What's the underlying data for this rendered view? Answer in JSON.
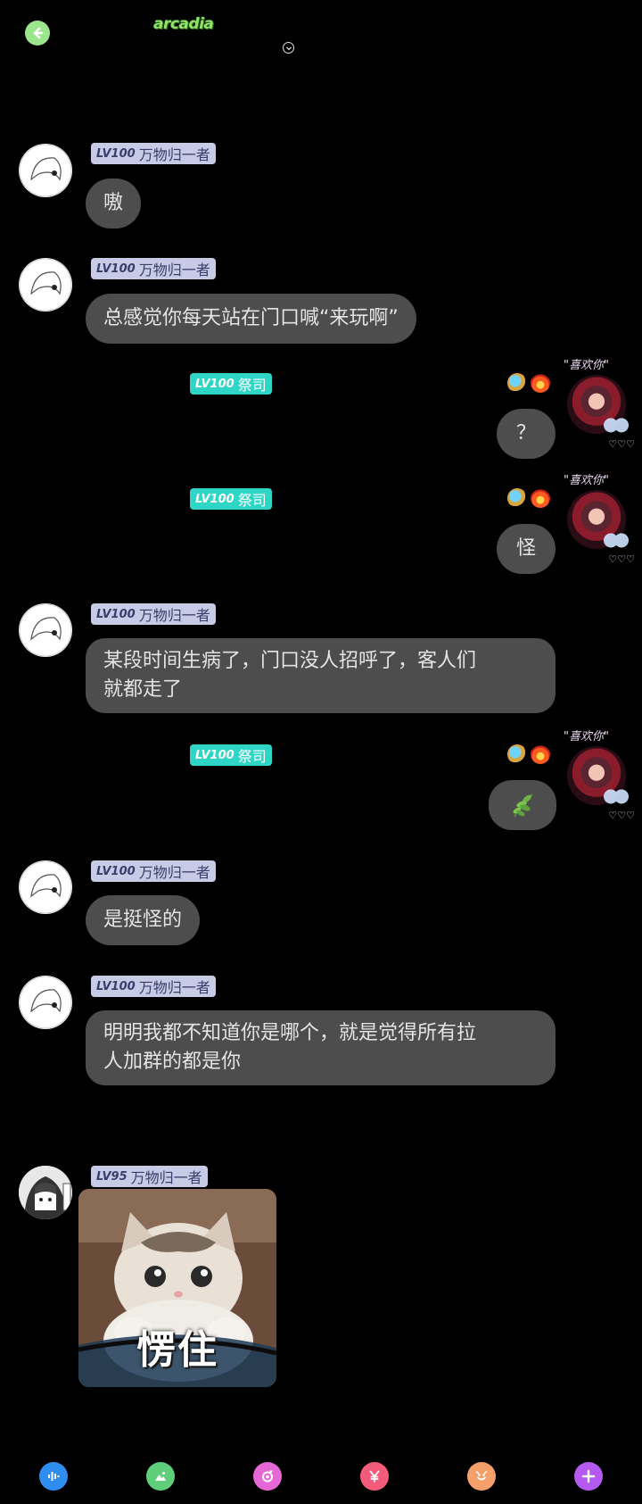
{
  "header": {
    "logo_text": "arcadia",
    "colors": {
      "back": "#9be58c",
      "logo": "#8fe36a"
    }
  },
  "messages": [
    {
      "side": "left",
      "level": "LV100",
      "name": "万物归一者",
      "text": "嗷"
    },
    {
      "side": "left",
      "level": "LV100",
      "name": "万物归一者",
      "text": "总感觉你每天站在门口喊“来玩啊”"
    },
    {
      "side": "right",
      "level": "LV100",
      "name": "祭司",
      "text": "？"
    },
    {
      "side": "right",
      "level": "LV100",
      "name": "祭司",
      "text": "怪"
    },
    {
      "side": "left",
      "level": "LV100",
      "name": "万物归一者",
      "text": "某段时间生病了，门口没人招呼了，客人们就都走了",
      "lines": [
        "某段时间生病了，门口没人招呼了，客人们",
        "就都走了"
      ]
    },
    {
      "side": "right",
      "level": "LV100",
      "name": "祭司",
      "content": "leaf-emoji"
    },
    {
      "side": "left",
      "level": "LV100",
      "name": "万物归一者",
      "text": "是挺怪的"
    },
    {
      "side": "left",
      "level": "LV100",
      "name": "万物归一者",
      "text": "明明我都不知道你是哪个，就是觉得所有拉人加群的都是你",
      "lines": [
        "明明我都不知道你是哪个，就是觉得所有拉",
        "人加群的都是你"
      ]
    },
    {
      "side": "left",
      "level": "LV95",
      "name": "万物归一者",
      "content": "sticker",
      "sticker_caption": "愣住"
    }
  ],
  "self_avatar_deco": {
    "top": "\"喜欢你\"",
    "hearts": "♡♡♡"
  },
  "bottom_bar": [
    {
      "icon": "voice-icon",
      "color": "#2f8df0"
    },
    {
      "icon": "image-icon",
      "color": "#5fce7a"
    },
    {
      "icon": "camera-icon",
      "color": "#e667d6"
    },
    {
      "icon": "yen-icon",
      "color": "#f25b7a"
    },
    {
      "icon": "emoji-icon",
      "color": "#f5a06a"
    },
    {
      "icon": "plus-icon",
      "color": "#b45af0"
    }
  ]
}
